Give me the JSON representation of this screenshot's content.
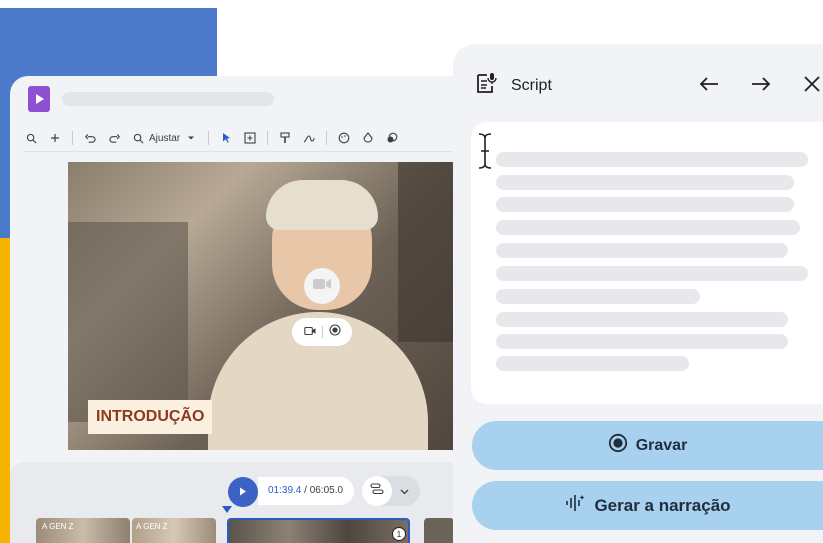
{
  "colors": {
    "accent_blue": "#4a7ac9",
    "panel_bg": "#f1f3f6",
    "button_bg": "#a8d0ef",
    "stripe_red": "#e0463a",
    "stripe_yellow": "#f4b400",
    "logo_purple": "#8f4fd1",
    "play_blue": "#3b62c4"
  },
  "editor": {
    "toolbar": {
      "zoom_label": "Ajustar",
      "icons": [
        "zoom-out-icon",
        "zoom-in-icon",
        "undo-icon",
        "redo-icon",
        "zoom-fit-icon",
        "dropdown-icon",
        "pointer-icon",
        "add-box-icon",
        "paint-format-icon",
        "ink-icon",
        "palette-icon",
        "fill-icon",
        "shapes-icon"
      ]
    },
    "video": {
      "overlay_label": "INTRODUÇÃO"
    },
    "timeline": {
      "current_time": "01:39.4",
      "total_time": "/ 06:05.0",
      "clip_labels": [
        "A GEN Z",
        "A GEN Z"
      ],
      "clip_badge": "1"
    }
  },
  "script_panel": {
    "title": "Script",
    "buttons": {
      "record": "Gravar",
      "generate": "Gerar a narração"
    }
  }
}
